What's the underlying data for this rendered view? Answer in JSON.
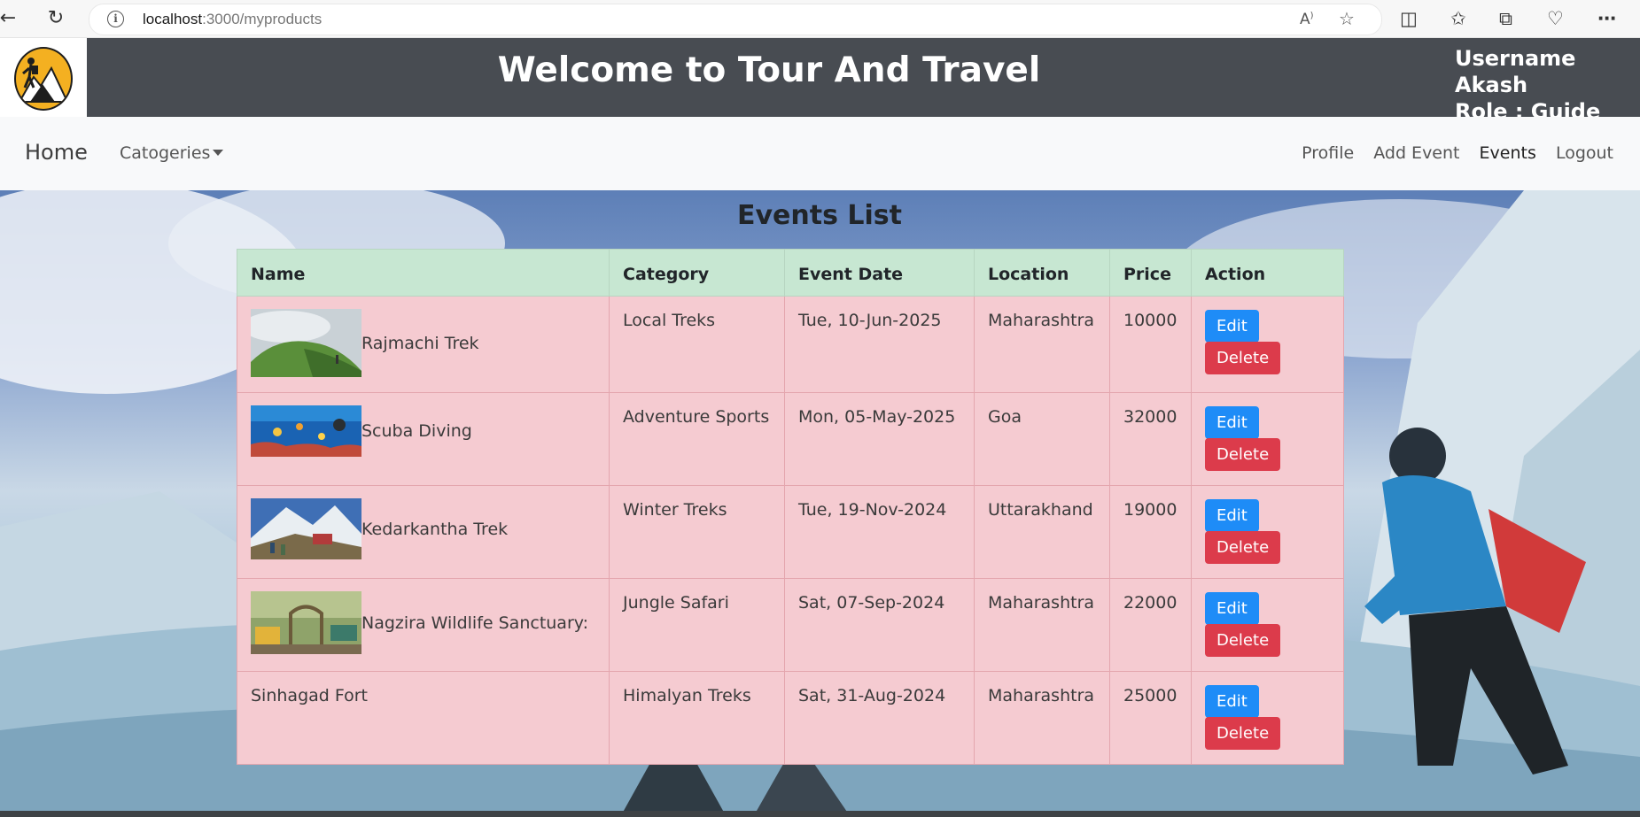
{
  "browser": {
    "url_host": "localhost",
    "url_rest": ":3000/myproducts",
    "icons": [
      "back-icon",
      "reload-icon",
      "info-icon",
      "read-aloud-icon",
      "favorite-star-icon",
      "split-screen-icon",
      "favorites-icon",
      "collections-icon",
      "health-icon",
      "more-icon"
    ]
  },
  "header": {
    "title": "Welcome to Tour And Travel",
    "username": "Username Akash",
    "role": "Role : Guide"
  },
  "nav": {
    "brand": "Home",
    "dropdown": "Catogeries",
    "links": [
      "Profile",
      "Add Event",
      "Events",
      "Logout"
    ]
  },
  "events": {
    "title": "Events List",
    "columns": [
      "Name",
      "Category",
      "Event Date",
      "Location",
      "Price",
      "Action"
    ],
    "rows": [
      {
        "name": "Rajmachi Trek",
        "category": "Local Treks",
        "date": "Tue, 10-Jun-2025",
        "location": "Maharashtra",
        "price": "10000",
        "image": "trek-hill-photo"
      },
      {
        "name": "Scuba Diving",
        "category": "Adventure Sports",
        "date": "Mon, 05-May-2025",
        "location": "Goa",
        "price": "32000",
        "image": "underwater-photo"
      },
      {
        "name": "Kedarkantha Trek",
        "category": "Winter Treks",
        "date": "Tue, 19-Nov-2024",
        "location": "Uttarakhand",
        "price": "19000",
        "image": "snow-mountain-photo"
      },
      {
        "name": "Nagzira Wildlife Sanctuary:",
        "category": "Jungle Safari",
        "date": "Sat, 07-Sep-2024",
        "location": "Maharashtra",
        "price": "22000",
        "image": "forest-gate-photo"
      },
      {
        "name": "Sinhagad Fort",
        "category": "Himalyan Treks",
        "date": "Sat, 31-Aug-2024",
        "location": "Maharashtra",
        "price": "25000",
        "image": ""
      }
    ],
    "edit_label": "Edit",
    "delete_label": "Delete"
  },
  "colors": {
    "header_bg": "#484c52",
    "table_header_bg": "#c7e7d2",
    "row_bg": "#f5cbd1",
    "edit_btn": "#1e8cf7",
    "delete_btn": "#dc3b4b"
  }
}
